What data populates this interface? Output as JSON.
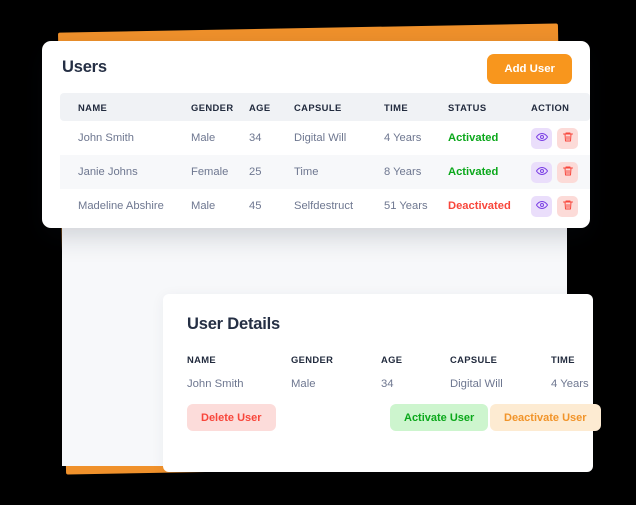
{
  "colors": {
    "brand_orange": "#F8961D",
    "backdrop_orange": "#F0912B",
    "activated_green": "#0BA81B",
    "deactivated_red": "#F8463B",
    "heading_navy": "#252F44",
    "body_gray": "#6E7790",
    "table_header_bg": "#F0F2F5",
    "row_alt_bg": "#F7F8FA",
    "view_icon_bg": "#EADEFB",
    "delete_icon_bg": "#FCDBD8",
    "delete_btn_bg": "#FCDCDA",
    "activate_btn_bg": "#CDF5CE",
    "deactivate_btn_bg": "#FDEBD2"
  },
  "users_card": {
    "title": "Users",
    "add_user_label": "Add User",
    "columns": [
      "NAME",
      "GENDER",
      "AGE",
      "CAPSULE",
      "TIME",
      "STATUS",
      "ACTION"
    ],
    "rows": [
      {
        "name": "John Smith",
        "gender": "Male",
        "age": "34",
        "capsule": "Digital Will",
        "time": "4 Years",
        "status": "Activated",
        "view_icon": "eye-icon",
        "delete_icon": "trash-icon"
      },
      {
        "name": "Janie Johns",
        "gender": "Female",
        "age": "25",
        "capsule": "Time",
        "time": "8 Years",
        "status": "Activated",
        "view_icon": "eye-icon",
        "delete_icon": "trash-icon"
      },
      {
        "name": "Madeline Abshire",
        "gender": "Male",
        "age": "45",
        "capsule": "Selfdestruct",
        "time": "51 Years",
        "status": "Deactivated",
        "view_icon": "eye-icon",
        "delete_icon": "trash-icon"
      }
    ]
  },
  "user_details": {
    "title": "User Details",
    "fields": [
      {
        "label": "NAME",
        "value": "John Smith"
      },
      {
        "label": "GENDER",
        "value": "Male"
      },
      {
        "label": "AGE",
        "value": "34"
      },
      {
        "label": "CAPSULE",
        "value": "Digital Will"
      },
      {
        "label": "TIME",
        "value": "4 Years"
      }
    ],
    "delete_label": "Delete User",
    "activate_label": "Activate User",
    "deactivate_label": "Deactivate User"
  }
}
